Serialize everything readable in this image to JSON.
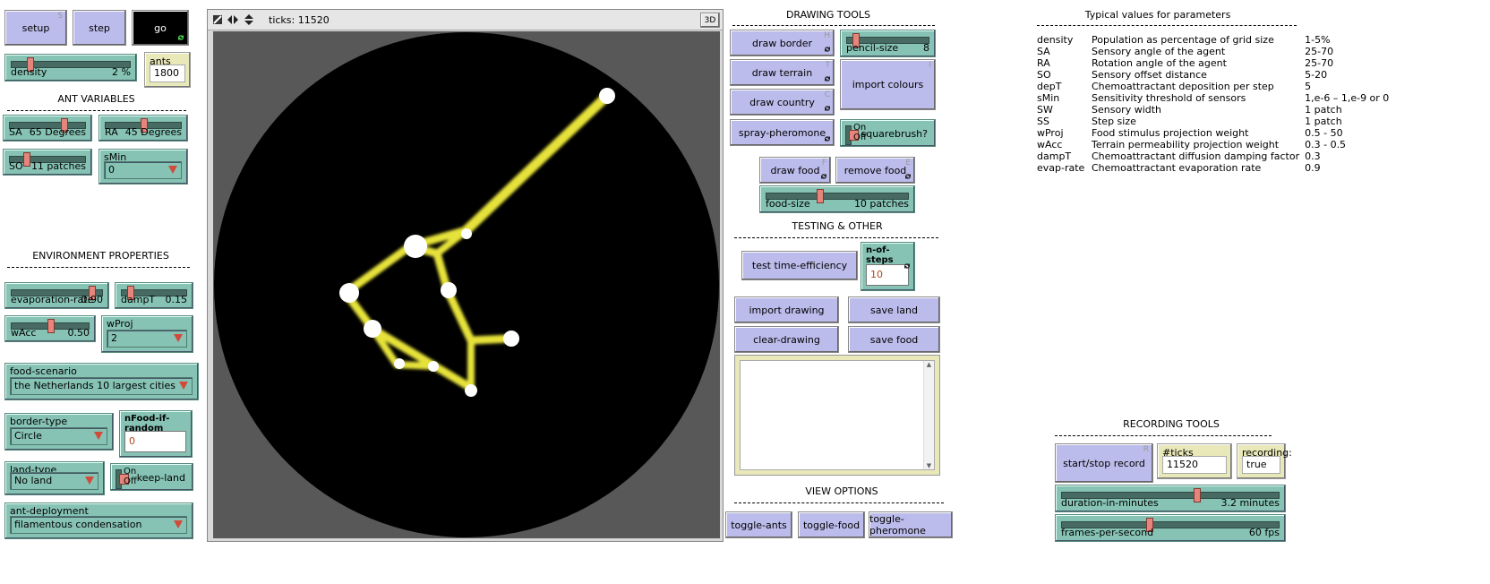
{
  "controls": {
    "setup": {
      "label": "setup",
      "hotkey": "S"
    },
    "step": {
      "label": "step"
    },
    "go": {
      "label": "go"
    },
    "density": {
      "label": "density",
      "value": "2 %",
      "level": 0.14
    },
    "ants": {
      "label": "ants",
      "value": "1800"
    }
  },
  "ant_variables": {
    "title": "ANT VARIABLES",
    "SA": {
      "label": "SA",
      "value": "65 Degrees",
      "level": 0.72
    },
    "RA": {
      "label": "RA",
      "value": "45 Degrees",
      "level": 0.5
    },
    "SO": {
      "label": "SO",
      "value": "11 patches",
      "level": 0.2
    },
    "sMin": {
      "label": "sMin",
      "value": "0"
    }
  },
  "environment": {
    "title": "ENVIRONMENT PROPERTIES",
    "evaporation_rate": {
      "label": "evaporation-rate",
      "value": "0.90",
      "level": 0.9
    },
    "dampT": {
      "label": "dampT",
      "value": "0.15",
      "level": 0.1
    },
    "wAcc": {
      "label": "wAcc",
      "value": "0.50",
      "level": 0.5
    },
    "wProj": {
      "label": "wProj",
      "value": "2"
    },
    "food_scenario": {
      "label": "food-scenario",
      "value": "the Netherlands 10 largest cities"
    },
    "border_type": {
      "label": "border-type",
      "value": "Circle"
    },
    "nFood_if_random": {
      "label": "nFood-if-random",
      "value": "0"
    },
    "land_type": {
      "label": "land-type",
      "value": "No land"
    },
    "keep_land": {
      "label": "keep-land",
      "on": "On",
      "off": "Off",
      "state": "Off"
    },
    "ant_deployment": {
      "label": "ant-deployment",
      "value": "filamentous condensation"
    }
  },
  "view": {
    "ticks_label": "ticks: 11520",
    "btn_3d": "3D",
    "background": "#000000",
    "trail_color": "#e6e23a",
    "food_color": "#ffffff"
  },
  "drawing_tools": {
    "title": "DRAWING TOOLS",
    "draw_border": {
      "label": "draw border",
      "hotkey": "H"
    },
    "pencil_size": {
      "label": "pencil-size",
      "value": "8",
      "level": 0.08
    },
    "draw_terrain": {
      "label": "draw terrain",
      "hotkey": "T"
    },
    "import_colours": {
      "label": "import colours",
      "hotkey": "I"
    },
    "draw_country": {
      "label": "draw country",
      "hotkey": "C"
    },
    "spray_pheromone": {
      "label": "spray-pheromone"
    },
    "squarebrush": {
      "label": "squarebrush?",
      "on": "On",
      "off": "Off",
      "state": "Off"
    },
    "draw_food": {
      "label": "draw food",
      "hotkey": "F"
    },
    "remove_food": {
      "label": "remove food",
      "hotkey": "E"
    },
    "food_size": {
      "label": "food-size",
      "value": "10 patches",
      "level": 0.37
    }
  },
  "testing": {
    "title": "TESTING & OTHER",
    "test_time_efficiency": {
      "label": "test time-efficiency"
    },
    "n_of_steps": {
      "label": "n-of-steps",
      "value": "10"
    },
    "import_drawing": {
      "label": "import drawing"
    },
    "save_land": {
      "label": "save land"
    },
    "clear_drawing": {
      "label": "clear-drawing"
    },
    "save_food": {
      "label": "save food"
    }
  },
  "view_options": {
    "title": "VIEW OPTIONS",
    "toggle_ants": {
      "label": "toggle-ants"
    },
    "toggle_food": {
      "label": "toggle-food"
    },
    "toggle_pheromone": {
      "label": "toggle-pheromone"
    }
  },
  "parameters": {
    "title": "Typical values for parameters",
    "rows": [
      [
        "density",
        "Population as percentage of grid size",
        "1-5%"
      ],
      [
        "SA",
        "Sensory angle of the agent",
        "25-70"
      ],
      [
        "RA",
        "Rotation angle of the agent",
        "25-70"
      ],
      [
        "SO",
        "Sensory offset distance",
        "5-20"
      ],
      [
        "depT",
        "Chemoattractant deposition per step",
        "5"
      ],
      [
        "sMin",
        "Sensitivity threshold of sensors",
        "1,e-6 – 1,e-9 or 0"
      ],
      [
        "SW",
        "Sensory width",
        "1 patch"
      ],
      [
        "SS",
        "Step size",
        "1 patch"
      ],
      [
        "wProj",
        "Food stimulus projection weight",
        "0.5 - 50"
      ],
      [
        "wAcc",
        "Terrain permeability projection weight",
        "0.3 - 0.5"
      ],
      [
        "dampT",
        "Chemoattractant diffusion damping factor",
        "0.3"
      ],
      [
        "evap-rate",
        "Chemoattractant evaporation rate",
        "0.9"
      ]
    ]
  },
  "recording": {
    "title": "RECORDING TOOLS",
    "start_stop": {
      "label": "start/stop record",
      "hotkey": "R"
    },
    "ticks_recording": {
      "label": "#ticks recording:",
      "value": "11520"
    },
    "recording": {
      "label": "recording:",
      "value": "true"
    },
    "duration": {
      "label": "duration-in-minutes",
      "value": "3.2 minutes",
      "level": 0.62
    },
    "fps": {
      "label": "frames-per-second",
      "value": "60 fps",
      "level": 0.4
    }
  }
}
